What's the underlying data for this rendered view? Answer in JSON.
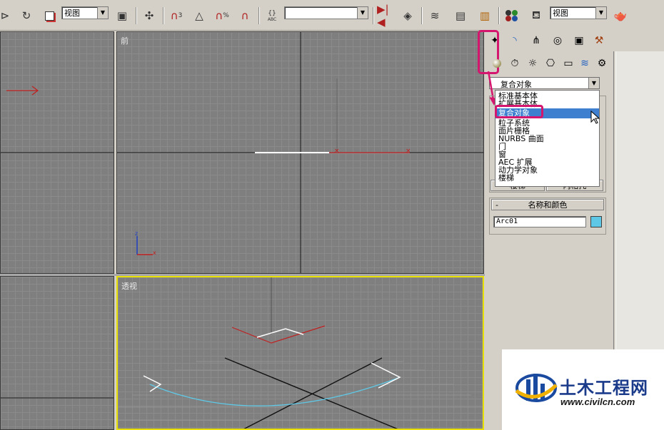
{
  "toolbar": {
    "view_combo_1": "视图",
    "view_combo_2": "视图",
    "snap_angle": "3",
    "snap_percent": "%",
    "named_selection": "",
    "text_abc": "ABC"
  },
  "viewports": {
    "front_label": "前",
    "perspective_label": "透视",
    "axis_z": "z",
    "axis_x": "x"
  },
  "command_panel": {
    "category_selected": "复合对象",
    "category_options": [
      "标准基本体",
      "扩展基本体",
      "复合对象",
      "粒子系统",
      "面片栅格",
      "NURBS 曲面",
      "门",
      "窗",
      "AEC 扩展",
      "动力学对象",
      "楼梯"
    ],
    "partial_button_1": "楼梯",
    "partial_button_2": "内格托",
    "name_color_title": "名称和颜色",
    "rollout_minus": "-",
    "object_name": "Arc01",
    "object_color": "#5fc8e6",
    "highlight_color": "#d4166e"
  },
  "logo": {
    "brand_cn": "土木工程网",
    "brand_url": "www.civilcn.com"
  }
}
